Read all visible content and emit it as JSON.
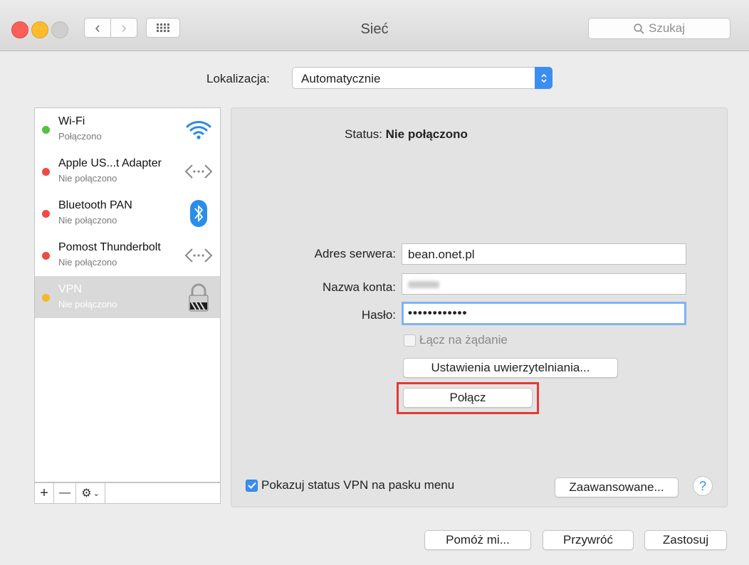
{
  "window": {
    "title": "Sieć"
  },
  "toolbar": {
    "search_placeholder": "Szukaj"
  },
  "location": {
    "label": "Lokalizacja:",
    "value": "Automatycznie"
  },
  "services": [
    {
      "name": "Wi-Fi",
      "status": "Połączono",
      "dot": "#55c040",
      "icon": "wifi-icon"
    },
    {
      "name": "Apple US...t Adapter",
      "status": "Nie połączono",
      "dot": "#ef4a44",
      "icon": "ethernet-icon"
    },
    {
      "name": "Bluetooth PAN",
      "status": "Nie połączono",
      "dot": "#ef4a44",
      "icon": "bluetooth-icon"
    },
    {
      "name": "Pomost Thunderbolt",
      "status": "Nie połączono",
      "dot": "#ef4a44",
      "icon": "ethernet-icon"
    },
    {
      "name": "VPN",
      "status": "Nie połączono",
      "dot": "#f5b72c",
      "icon": "lock-icon",
      "selected": true
    }
  ],
  "list_toolbar": {
    "add": "+",
    "remove": "—",
    "action": "⚙"
  },
  "detail": {
    "status_label": "Status:",
    "status_value": "Nie połączono",
    "server_label": "Adres serwera:",
    "server_value": "bean.onet.pl",
    "account_label": "Nazwa konta:",
    "password_label": "Hasło:",
    "password_value": "••••••••••••",
    "connect_on_demand": "Łącz na żądanie",
    "auth_settings_button": "Ustawienia uwierzytelniania...",
    "connect_button": "Połącz",
    "show_vpn_status": "Pokazuj status VPN na pasku menu",
    "advanced_button": "Zaawansowane...",
    "help_button": "?"
  },
  "footer": {
    "assist": "Pomóż mi...",
    "revert": "Przywróć",
    "apply": "Zastosuj"
  },
  "colors": {
    "accent": "#3b8ef0",
    "highlight": "#e53935"
  }
}
